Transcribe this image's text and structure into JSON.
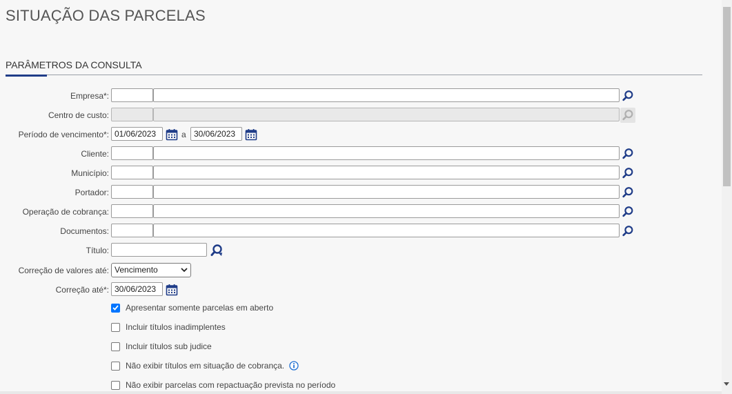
{
  "page": {
    "title": "SITUAÇÃO DAS PARCELAS"
  },
  "section": {
    "title": "PARÂMETROS DA CONSULTA"
  },
  "fields": {
    "empresa": {
      "label": "Empresa*:",
      "code": "",
      "name": ""
    },
    "centro_custo": {
      "label": "Centro de custo:",
      "code": "",
      "name": ""
    },
    "periodo": {
      "label": "Período de vencimento*:",
      "start": "01/06/2023",
      "separator": "a",
      "end": "30/06/2023"
    },
    "cliente": {
      "label": "Cliente:",
      "code": "",
      "name": ""
    },
    "municipio": {
      "label": "Município:",
      "code": "",
      "name": ""
    },
    "portador": {
      "label": "Portador:",
      "code": "",
      "name": ""
    },
    "operacao": {
      "label": "Operação de cobrança:",
      "code": "",
      "name": ""
    },
    "documentos": {
      "label": "Documentos:",
      "code": "",
      "name": ""
    },
    "titulo": {
      "label": "Título:",
      "value": ""
    },
    "correcao_valores": {
      "label": "Correção de valores até:",
      "selected": "Vencimento"
    },
    "correcao_ate": {
      "label": "Correção até*:",
      "value": "30/06/2023"
    }
  },
  "options": [
    {
      "label": "Apresentar somente parcelas em aberto",
      "checked": true
    },
    {
      "label": "Incluir títulos inadimplentes",
      "checked": false
    },
    {
      "label": "Incluir títulos sub judice",
      "checked": false
    },
    {
      "label": "Não exibir títulos em situação de cobrança.",
      "checked": false,
      "info_icon": "info-icon"
    },
    {
      "label": "Não exibir parcelas com repactuação prevista no período",
      "checked": false
    }
  ],
  "colors": {
    "accent": "#1f3c88",
    "icon": "#1f3c88",
    "checkbox": "#0075ff"
  }
}
